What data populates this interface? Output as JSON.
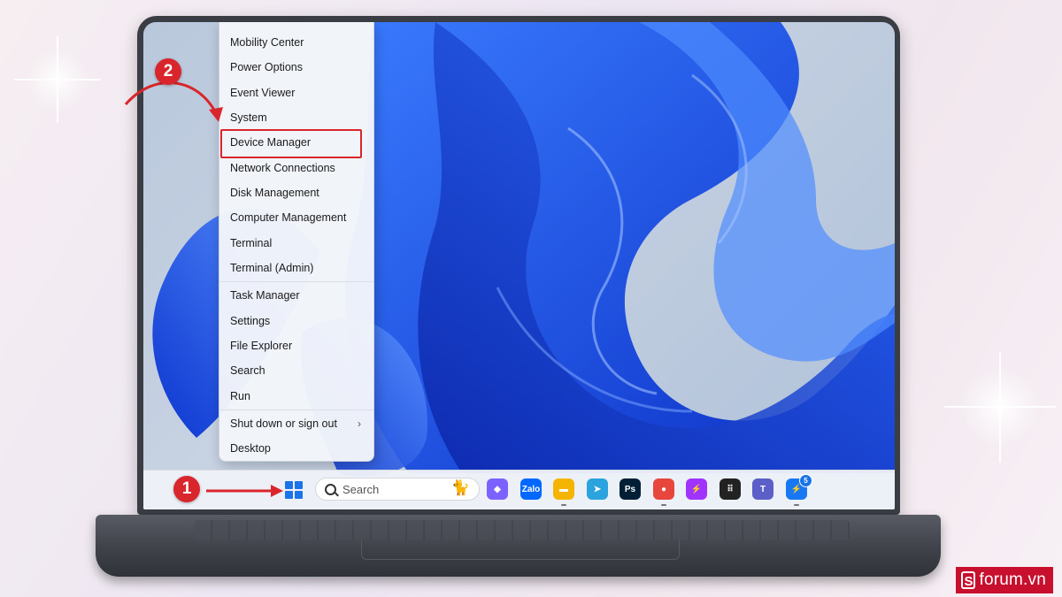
{
  "context_menu": {
    "items_top": [
      {
        "label": "Mobility Center",
        "key": "mobility"
      },
      {
        "label": "Power Options",
        "key": "power"
      },
      {
        "label": "Event Viewer",
        "key": "event-viewer"
      },
      {
        "label": "System",
        "key": "system"
      },
      {
        "label": "Device Manager",
        "key": "device-manager"
      },
      {
        "label": "Network Connections",
        "key": "network"
      },
      {
        "label": "Disk Management",
        "key": "disk"
      },
      {
        "label": "Computer Management",
        "key": "computer-mgmt"
      },
      {
        "label": "Terminal",
        "key": "terminal"
      },
      {
        "label": "Terminal (Admin)",
        "key": "terminal-admin"
      }
    ],
    "items_middle": [
      {
        "label": "Task Manager",
        "key": "task-manager"
      },
      {
        "label": "Settings",
        "key": "settings"
      },
      {
        "label": "File Explorer",
        "key": "file-explorer"
      },
      {
        "label": "Search",
        "key": "search"
      },
      {
        "label": "Run",
        "key": "run"
      }
    ],
    "shutdown_label": "Shut down or sign out",
    "shutdown_chevron": "›",
    "desktop_label": "Desktop",
    "highlighted_item": "Device Manager"
  },
  "taskbar": {
    "search_placeholder": "Search",
    "search_highlight_icon": "cat-illustration-icon",
    "apps": [
      {
        "name": "copilot",
        "icon": "copilot-icon",
        "glyph": "◆",
        "color": "#7b61ff"
      },
      {
        "name": "zalo",
        "icon": "zalo-icon",
        "glyph": "Zalo",
        "color": "#0068ff"
      },
      {
        "name": "file-explorer",
        "icon": "folder-icon",
        "glyph": "▬",
        "color": "#f4b400",
        "running": true
      },
      {
        "name": "telegram",
        "icon": "telegram-icon",
        "glyph": "➤",
        "color": "#2aa3de"
      },
      {
        "name": "photoshop",
        "icon": "photoshop-icon",
        "glyph": "Ps",
        "color": "#001e36"
      },
      {
        "name": "chrome",
        "icon": "chrome-icon",
        "glyph": "●",
        "color": "#e8453c",
        "running": true
      },
      {
        "name": "messenger",
        "icon": "messenger-icon",
        "glyph": "⚡",
        "color": "#a033ff"
      },
      {
        "name": "apps-grid",
        "icon": "apps-grid-icon",
        "glyph": "⠿",
        "color": "#222222"
      },
      {
        "name": "teams",
        "icon": "teams-icon",
        "glyph": "T",
        "color": "#5b5fc7"
      },
      {
        "name": "messenger-2",
        "icon": "messenger-badge-icon",
        "glyph": "⚡",
        "color": "#1877f2",
        "badge": "5",
        "running": true
      }
    ]
  },
  "annotations": {
    "step1": "1",
    "step2": "2"
  },
  "watermark": {
    "logo": "S",
    "text": "forum.vn"
  },
  "colors": {
    "accent_red": "#d9262c",
    "windows_blue": "#1a73e8",
    "wallpaper_blue": "#1240d6"
  }
}
